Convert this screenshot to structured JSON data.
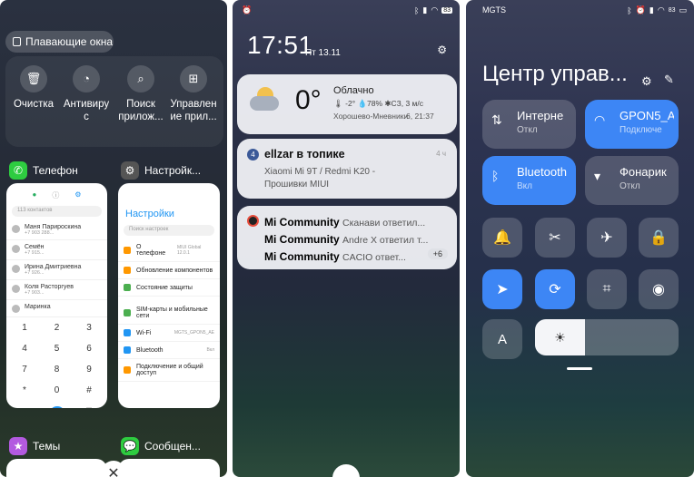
{
  "recents": {
    "floating_windows_label": "Плавающие окна",
    "tools": [
      {
        "label": "Очистка",
        "icon": "trash-icon"
      },
      {
        "label": "Антивиру\nс",
        "icon": "antivirus-icon"
      },
      {
        "label": "Поиск\nприлож...",
        "icon": "search-icon"
      },
      {
        "label": "Управлен\nие прил...",
        "icon": "apps-grid-icon"
      }
    ],
    "apps": [
      {
        "name": "Телефон",
        "color": "#2ecc40"
      },
      {
        "name": "Настройк...",
        "color": "#555555"
      },
      {
        "name": "Темы",
        "color": "#b35ae0"
      },
      {
        "name": "Сообщен...",
        "color": "#2ecc40"
      }
    ],
    "phone_card": {
      "search_placeholder": "113 контактов",
      "contacts": [
        {
          "name": "Маня Парироскина",
          "sub": "+7 903 288..."
        },
        {
          "name": "Семён",
          "sub": "+7 915..."
        },
        {
          "name": "Ирина Дмитриевна",
          "sub": "+7 926..."
        },
        {
          "name": "Коля Расторгуев",
          "sub": "+7 903..."
        },
        {
          "name": "Маринка",
          "sub": ""
        }
      ],
      "keys": [
        "1",
        "2",
        "3",
        "4",
        "5",
        "6",
        "7",
        "8",
        "9",
        "*",
        "0",
        "#"
      ]
    },
    "settings_card": {
      "title": "Настройки",
      "search_placeholder": "Поиск настроек",
      "rows": [
        {
          "label": "О телефоне",
          "value": "MIUI Global 12.0.1",
          "color": "#ff9800"
        },
        {
          "label": "Обновление компонентов",
          "value": "",
          "color": "#ff9800"
        },
        {
          "label": "Состояние защиты",
          "value": "",
          "color": "#4caf50"
        },
        {
          "label": "SIM-карты и мобильные сети",
          "value": "",
          "color": "#4caf50"
        },
        {
          "label": "Wi-Fi",
          "value": "MGTS_GPON5_AE",
          "color": "#2196f3"
        },
        {
          "label": "Bluetooth",
          "value": "Вкл",
          "color": "#2196f3"
        },
        {
          "label": "Подключение и общий доступ",
          "value": "",
          "color": "#ff9800"
        }
      ]
    }
  },
  "shade": {
    "battery": "83",
    "time": "17:51",
    "date": "Пт 13.11",
    "weather": {
      "temp": "0°",
      "cond": "Облачно",
      "details": "🌡 -2°  💧78%  ✱СЗ, 3 м/с",
      "location": "Хорошево-Мневники",
      "updated": "6, 21:37"
    },
    "notif_topic": {
      "title": "ellzar в топике",
      "age": "4 ч",
      "body": "Xiaomi Mi 9T / Redmi K20 -\nПрошивки MIUI"
    },
    "notif_community": {
      "rows": [
        {
          "app": "Mi Community",
          "text": "Сканави  ответил..."
        },
        {
          "app": "Mi Community",
          "text": "Andre X  ответил т..."
        },
        {
          "app": "Mi Community",
          "text": "CACIO  ответ..."
        }
      ],
      "more": "+6"
    }
  },
  "control_center": {
    "carrier": "MGTS",
    "battery": "83",
    "title": "Центр управ...",
    "tiles": [
      {
        "label": "Интерне",
        "sub": "Откл",
        "icon": "data-arrows-icon",
        "on": false
      },
      {
        "label": "GPON5_A",
        "sub": "Подключе",
        "icon": "wifi-icon",
        "on": true
      },
      {
        "label": "Bluetooth",
        "sub": "Вкл",
        "icon": "bluetooth-icon",
        "on": true
      },
      {
        "label": "Фонарик",
        "sub": "Откл",
        "icon": "flashlight-icon",
        "on": false
      }
    ],
    "toggles_row1": [
      "bell-icon",
      "screenshot-icon",
      "airplane-icon",
      "lock-icon"
    ],
    "toggles_row2": [
      "location-icon",
      "rotation-lock-icon",
      "scan-icon",
      "eye-icon"
    ],
    "auto_brightness_label": "A",
    "colors": {
      "accent": "#3d86f5"
    }
  }
}
